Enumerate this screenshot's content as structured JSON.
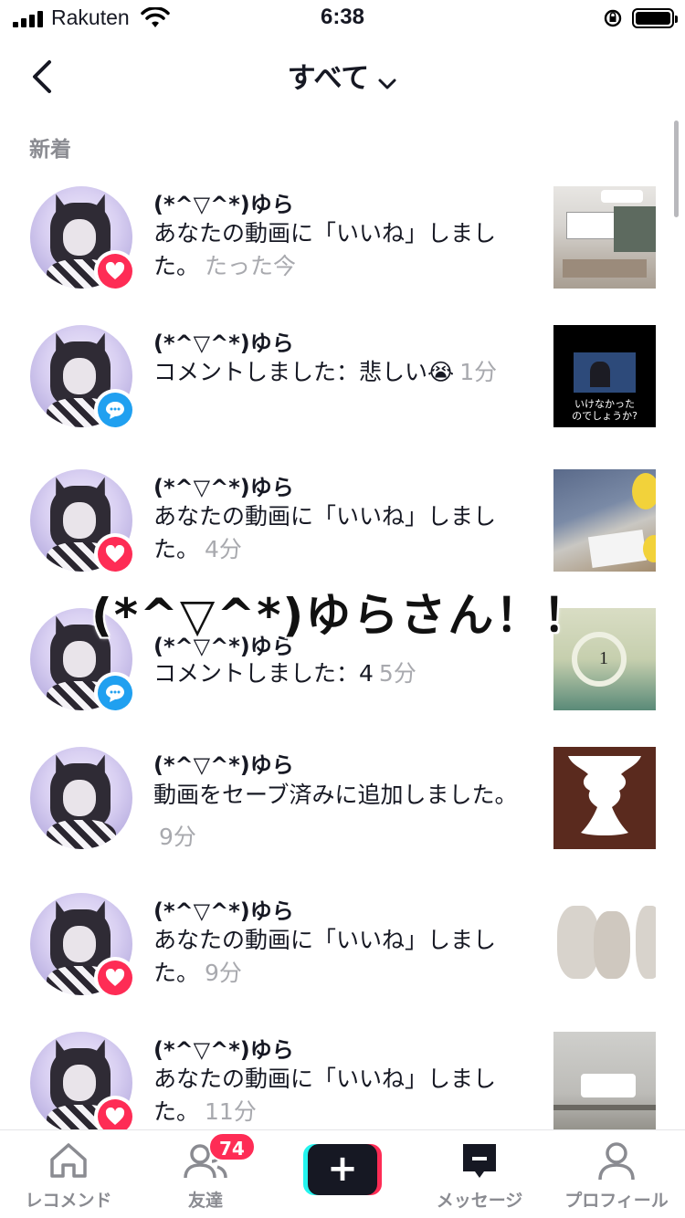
{
  "status_bar": {
    "carrier": "Rakuten",
    "time": "6:38"
  },
  "nav": {
    "title": "すべて"
  },
  "section": {
    "label": "新着"
  },
  "notifications": [
    {
      "user": "(*^▽^*)ゆら",
      "message": "あなたの動画に「いいね」しました。",
      "time": "たった今",
      "type": "like",
      "thumb_text": ""
    },
    {
      "user": "(*^▽^*)ゆら",
      "message": "コメントしました：悲しい😭",
      "time": "1分",
      "type": "comment",
      "thumb_text": "いけなかったのでしょうか?"
    },
    {
      "user": "(*^▽^*)ゆら",
      "message": "あなたの動画に「いいね」しました。",
      "time": "4分",
      "type": "like",
      "thumb_text": ""
    },
    {
      "user": "(*^▽^*)ゆら",
      "message": "コメントしました：4",
      "time": "5分",
      "type": "comment",
      "thumb_text": "1"
    },
    {
      "user": "(*^▽^*)ゆら",
      "message": "動画をセーブ済みに追加しました。",
      "time": "9分",
      "type": "save",
      "thumb_text": ""
    },
    {
      "user": "(*^▽^*)ゆら",
      "message": "あなたの動画に「いいね」しました。",
      "time": "9分",
      "type": "like",
      "thumb_text": ""
    },
    {
      "user": "(*^▽^*)ゆら",
      "message": "あなたの動画に「いいね」しました。",
      "time": "11分",
      "type": "like",
      "thumb_text": ""
    }
  ],
  "overlay_text": "(*^▽^*)ゆらさん！！",
  "tabbar": {
    "home": "レコメンド",
    "friends": "友達",
    "friends_badge": "74",
    "create": "+",
    "inbox": "メッセージ",
    "profile": "プロフィール"
  },
  "colors": {
    "like": "#fe2c55",
    "comment": "#20a0f0",
    "accent_cyan": "#25f4ee"
  }
}
